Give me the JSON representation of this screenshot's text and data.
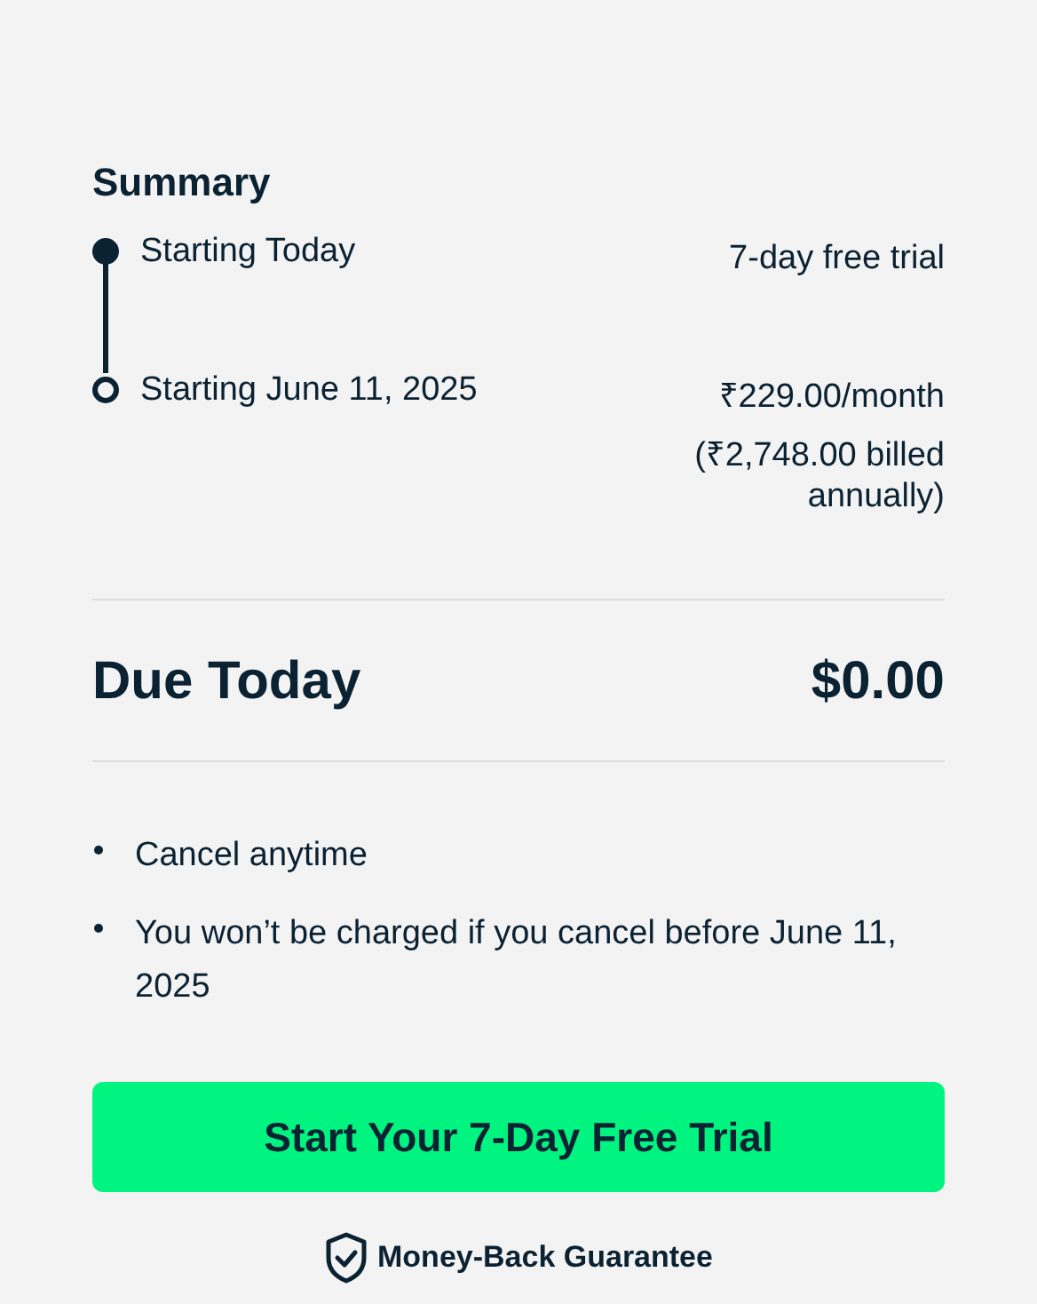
{
  "summary": {
    "title": "Summary",
    "steps": [
      {
        "label": "Starting Today",
        "filled": true,
        "price": [
          "7-day free trial"
        ]
      },
      {
        "label": "Starting June 11, 2025",
        "filled": false,
        "price": [
          "₹229.00/month",
          "(₹2,748.00 billed annually)"
        ]
      }
    ]
  },
  "due": {
    "label": "Due Today",
    "amount": "$0.00"
  },
  "notes": [
    "Cancel anytime",
    "You won’t be charged if you cancel before June 11, 2025"
  ],
  "cta": "Start Your 7-Day Free Trial",
  "guarantee": "Money-Back Guarantee"
}
